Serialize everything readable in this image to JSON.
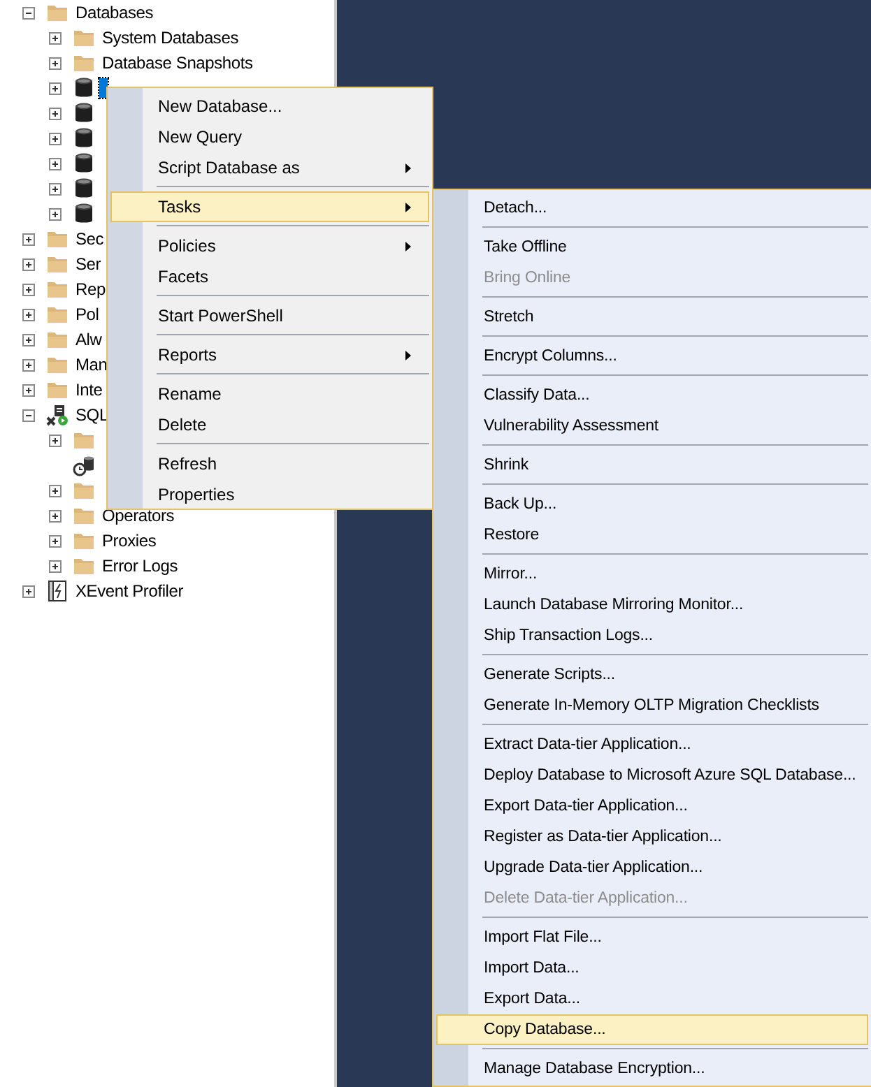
{
  "tree": [
    {
      "label": "Databases",
      "kind": "folder",
      "expandable": true,
      "expanded": true,
      "selected": false,
      "children": [
        {
          "label": "System Databases",
          "kind": "folder",
          "expandable": true,
          "expanded": false,
          "selected": false
        },
        {
          "label": "Database Snapshots",
          "kind": "folder",
          "expandable": true,
          "expanded": false,
          "selected": false
        },
        {
          "kind": "database",
          "expandable": true,
          "expanded": false,
          "selected": true
        },
        {
          "kind": "database",
          "expandable": true,
          "expanded": false,
          "selected": false
        },
        {
          "kind": "database",
          "expandable": true,
          "expanded": false,
          "selected": false
        },
        {
          "kind": "database",
          "expandable": true,
          "expanded": false,
          "selected": false
        },
        {
          "kind": "database",
          "expandable": true,
          "expanded": false,
          "selected": false
        },
        {
          "kind": "database",
          "expandable": true,
          "expanded": false,
          "selected": false
        }
      ]
    },
    {
      "label": "Sec",
      "kind": "folder",
      "expandable": true,
      "expanded": false,
      "selected": false
    },
    {
      "label": "Ser",
      "kind": "folder",
      "expandable": true,
      "expanded": false,
      "selected": false
    },
    {
      "label": "Rep",
      "kind": "folder",
      "expandable": true,
      "expanded": false,
      "selected": false
    },
    {
      "label": "Pol",
      "kind": "folder",
      "expandable": true,
      "expanded": false,
      "selected": false
    },
    {
      "label": "Alw",
      "kind": "folder",
      "expandable": true,
      "expanded": false,
      "selected": false
    },
    {
      "label": "Man",
      "kind": "folder",
      "expandable": true,
      "expanded": false,
      "selected": false
    },
    {
      "label": "Inte",
      "kind": "folder",
      "expandable": true,
      "expanded": false,
      "selected": false
    },
    {
      "label": "SQL",
      "kind": "agent",
      "expandable": true,
      "expanded": true,
      "selected": false,
      "children": [
        {
          "kind": "folder",
          "expandable": true,
          "expanded": false,
          "selected": false
        },
        {
          "kind": "monitor",
          "expandable": false,
          "expanded": false,
          "selected": false
        },
        {
          "kind": "folder",
          "expandable": true,
          "expanded": false,
          "selected": false
        },
        {
          "label": "Operators",
          "kind": "folder",
          "expandable": true,
          "expanded": false,
          "selected": false
        },
        {
          "label": "Proxies",
          "kind": "folder",
          "expandable": true,
          "expanded": false,
          "selected": false
        },
        {
          "label": "Error Logs",
          "kind": "folder",
          "expandable": true,
          "expanded": false,
          "selected": false
        }
      ]
    },
    {
      "label": "XEvent Profiler",
      "kind": "xevent",
      "expandable": true,
      "expanded": false,
      "selected": false
    }
  ],
  "context_menu": {
    "items": [
      {
        "kind": "item",
        "label": "New Database...",
        "submenu": false,
        "selected": false,
        "disabled": false
      },
      {
        "kind": "item",
        "label": "New Query",
        "submenu": false,
        "selected": false,
        "disabled": false
      },
      {
        "kind": "item",
        "label": "Script Database as",
        "submenu": true,
        "selected": false,
        "disabled": false
      },
      {
        "kind": "separator"
      },
      {
        "kind": "item",
        "label": "Tasks",
        "submenu": true,
        "selected": true,
        "disabled": false
      },
      {
        "kind": "separator"
      },
      {
        "kind": "item",
        "label": "Policies",
        "submenu": true,
        "selected": false,
        "disabled": false
      },
      {
        "kind": "item",
        "label": "Facets",
        "submenu": false,
        "selected": false,
        "disabled": false
      },
      {
        "kind": "separator"
      },
      {
        "kind": "item",
        "label": "Start PowerShell",
        "submenu": false,
        "selected": false,
        "disabled": false
      },
      {
        "kind": "separator"
      },
      {
        "kind": "item",
        "label": "Reports",
        "submenu": true,
        "selected": false,
        "disabled": false
      },
      {
        "kind": "separator"
      },
      {
        "kind": "item",
        "label": "Rename",
        "submenu": false,
        "selected": false,
        "disabled": false
      },
      {
        "kind": "item",
        "label": "Delete",
        "submenu": false,
        "selected": false,
        "disabled": false
      },
      {
        "kind": "separator"
      },
      {
        "kind": "item",
        "label": "Refresh",
        "submenu": false,
        "selected": false,
        "disabled": false
      },
      {
        "kind": "item",
        "label": "Properties",
        "submenu": false,
        "selected": false,
        "disabled": false
      }
    ]
  },
  "tasks_submenu": {
    "items": [
      {
        "kind": "item",
        "label": "Detach...",
        "selected": false,
        "disabled": false
      },
      {
        "kind": "separator"
      },
      {
        "kind": "item",
        "label": "Take Offline",
        "selected": false,
        "disabled": false
      },
      {
        "kind": "item",
        "label": "Bring Online",
        "selected": false,
        "disabled": true
      },
      {
        "kind": "separator"
      },
      {
        "kind": "item",
        "label": "Stretch",
        "selected": false,
        "disabled": false
      },
      {
        "kind": "separator"
      },
      {
        "kind": "item",
        "label": "Encrypt Columns...",
        "selected": false,
        "disabled": false
      },
      {
        "kind": "separator"
      },
      {
        "kind": "item",
        "label": "Classify Data...",
        "selected": false,
        "disabled": false
      },
      {
        "kind": "item",
        "label": "Vulnerability Assessment",
        "selected": false,
        "disabled": false
      },
      {
        "kind": "separator"
      },
      {
        "kind": "item",
        "label": "Shrink",
        "selected": false,
        "disabled": false
      },
      {
        "kind": "separator"
      },
      {
        "kind": "item",
        "label": "Back Up...",
        "selected": false,
        "disabled": false
      },
      {
        "kind": "item",
        "label": "Restore",
        "selected": false,
        "disabled": false
      },
      {
        "kind": "separator"
      },
      {
        "kind": "item",
        "label": "Mirror...",
        "selected": false,
        "disabled": false
      },
      {
        "kind": "item",
        "label": "Launch Database Mirroring Monitor...",
        "selected": false,
        "disabled": false
      },
      {
        "kind": "item",
        "label": "Ship Transaction Logs...",
        "selected": false,
        "disabled": false
      },
      {
        "kind": "separator"
      },
      {
        "kind": "item",
        "label": "Generate Scripts...",
        "selected": false,
        "disabled": false
      },
      {
        "kind": "item",
        "label": "Generate In-Memory OLTP Migration Checklists",
        "selected": false,
        "disabled": false
      },
      {
        "kind": "separator"
      },
      {
        "kind": "item",
        "label": "Extract Data-tier Application...",
        "selected": false,
        "disabled": false
      },
      {
        "kind": "item",
        "label": "Deploy Database to Microsoft Azure SQL Database...",
        "selected": false,
        "disabled": false
      },
      {
        "kind": "item",
        "label": "Export Data-tier Application...",
        "selected": false,
        "disabled": false
      },
      {
        "kind": "item",
        "label": "Register as Data-tier Application...",
        "selected": false,
        "disabled": false
      },
      {
        "kind": "item",
        "label": "Upgrade Data-tier Application...",
        "selected": false,
        "disabled": false
      },
      {
        "kind": "item",
        "label": "Delete Data-tier Application...",
        "selected": false,
        "disabled": true
      },
      {
        "kind": "separator"
      },
      {
        "kind": "item",
        "label": "Import Flat File...",
        "selected": false,
        "disabled": false
      },
      {
        "kind": "item",
        "label": "Import Data...",
        "selected": false,
        "disabled": false
      },
      {
        "kind": "item",
        "label": "Export Data...",
        "selected": false,
        "disabled": false
      },
      {
        "kind": "item",
        "label": "Copy Database...",
        "selected": true,
        "disabled": false
      },
      {
        "kind": "separator"
      },
      {
        "kind": "item",
        "label": "Manage Database Encryption...",
        "selected": false,
        "disabled": false
      }
    ]
  }
}
